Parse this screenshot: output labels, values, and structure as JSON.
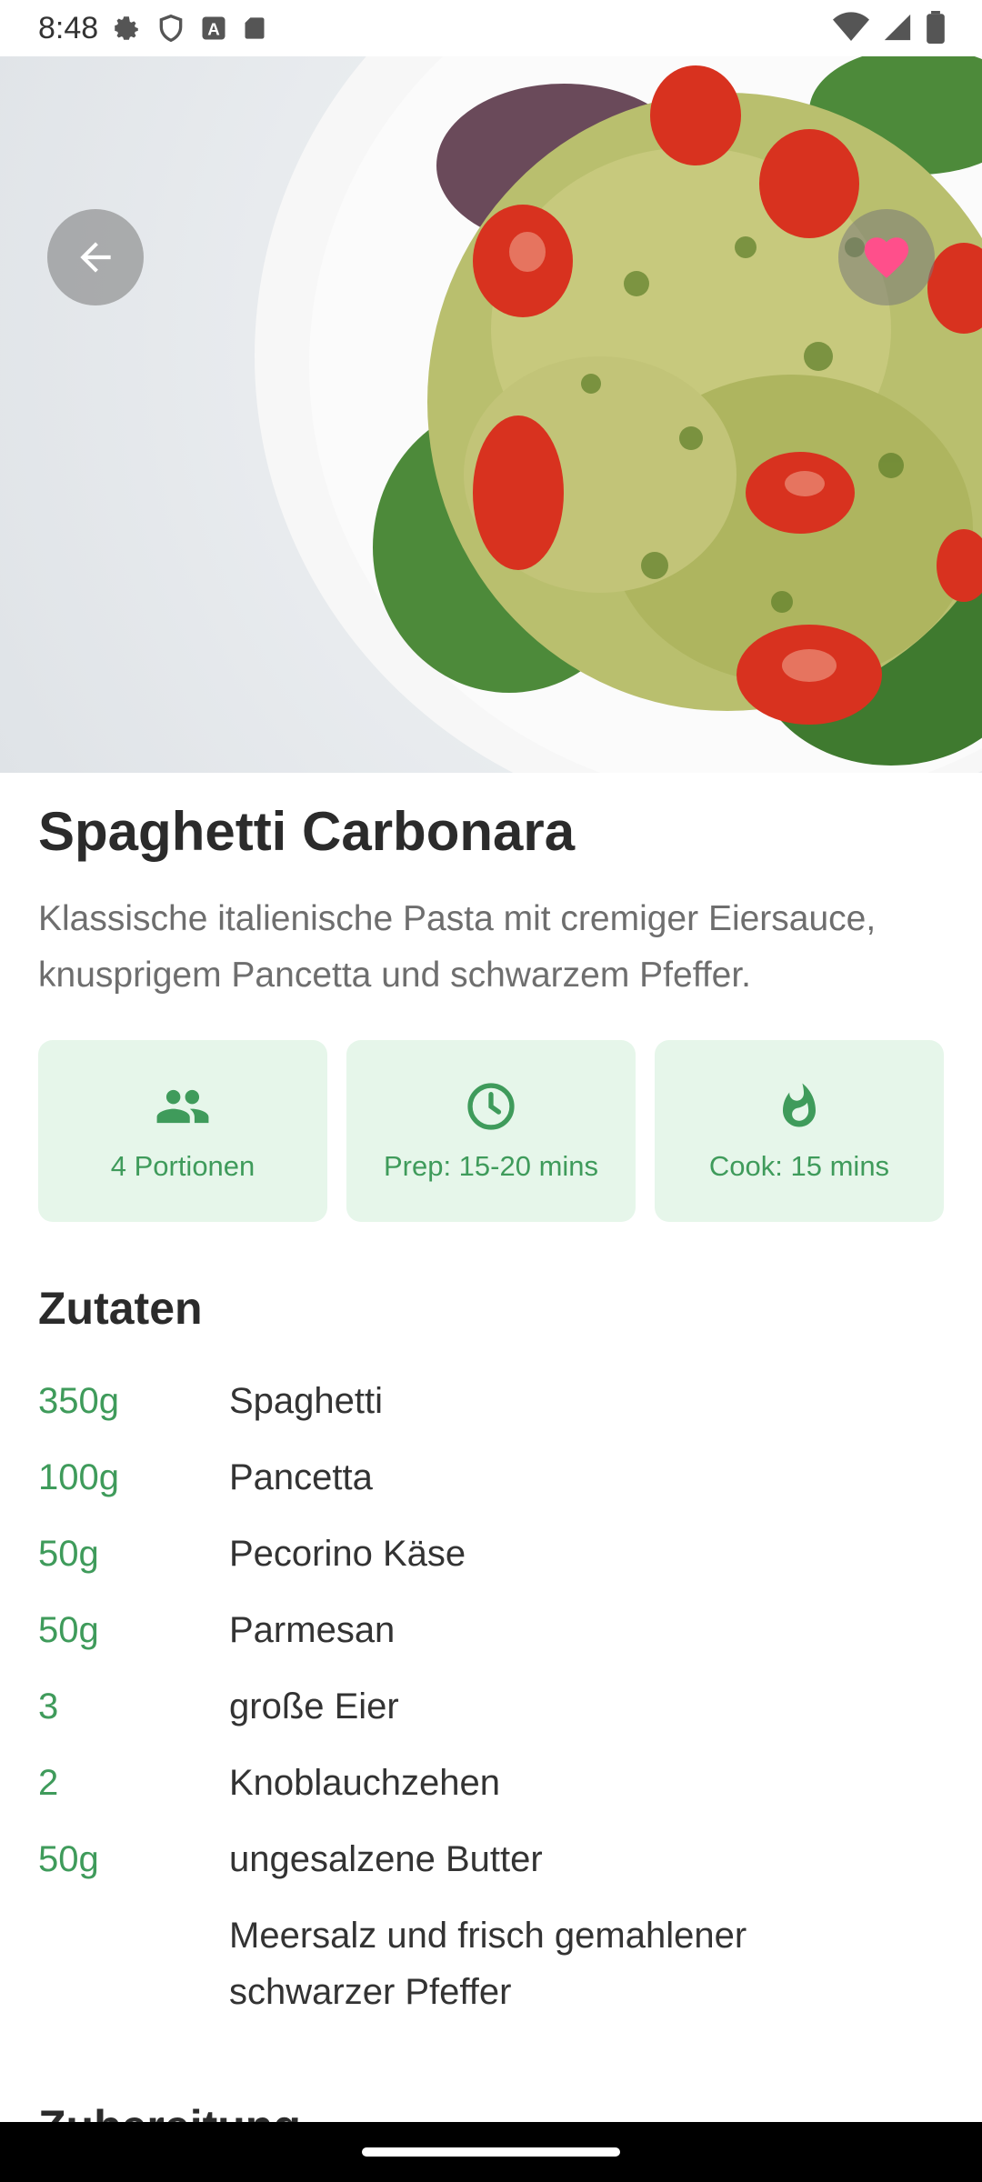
{
  "status_bar": {
    "time": "8:48",
    "left_icons": [
      "gear-icon",
      "shield-icon",
      "a-badge-icon",
      "sd-card-icon"
    ],
    "right_icons": [
      "wifi-icon",
      "signal-icon",
      "battery-icon"
    ]
  },
  "hero": {
    "image": "pasta-salad-photo",
    "back_icon": "arrow-left-icon",
    "favorite_icon": "heart-icon",
    "favorite_color": "#ff4f8b"
  },
  "recipe": {
    "title": "Spaghetti Carbonara",
    "description": "Klassische italienische Pasta mit cremiger Eiersauce, knusprigem Pancetta und schwarzem Pfeffer."
  },
  "stats": [
    {
      "icon": "people-icon",
      "label": "4 Portionen"
    },
    {
      "icon": "clock-icon",
      "label": "Prep: 15-20 mins"
    },
    {
      "icon": "flame-icon",
      "label": "Cook: 15 mins"
    }
  ],
  "ingredients": {
    "title": "Zutaten",
    "items": [
      {
        "qty": "350g",
        "name": "Spaghetti"
      },
      {
        "qty": "100g",
        "name": "Pancetta"
      },
      {
        "qty": "50g",
        "name": "Pecorino Käse"
      },
      {
        "qty": "50g",
        "name": "Parmesan"
      },
      {
        "qty": "3",
        "name": "große Eier"
      },
      {
        "qty": "2",
        "name": "Knoblauchzehen"
      },
      {
        "qty": "50g",
        "name": "ungesalzene Butter"
      },
      {
        "qty": "",
        "name": "Meersalz und frisch gemahlener schwarzer Pfeffer"
      }
    ]
  },
  "next_section_title": "Zubereitung",
  "colors": {
    "accent": "#3f9b5b",
    "stat_bg": "#e6f6ea"
  }
}
